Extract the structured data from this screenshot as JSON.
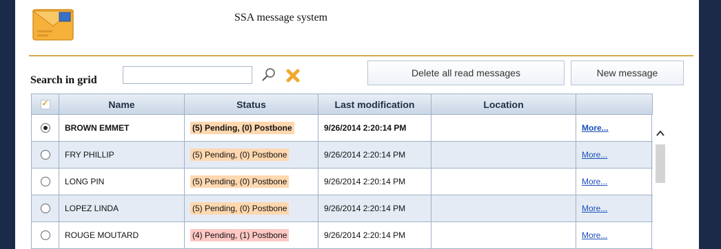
{
  "header": {
    "title": "SSA message system"
  },
  "search": {
    "label": "Search in grid",
    "value": "",
    "placeholder": ""
  },
  "toolbar": {
    "delete_read_label": "Delete all read messages",
    "new_message_label": "New message"
  },
  "grid": {
    "columns": [
      "",
      "Name",
      "Status",
      "Last modification",
      "Location",
      ""
    ],
    "rows": [
      {
        "name": "BROWN EMMET",
        "status": "(5) Pending, (0) Postbone",
        "modified": "9/26/2014 2:20:14 PM",
        "location": "",
        "more": "More..."
      },
      {
        "name": "FRY PHILLIP",
        "status": "(5) Pending, (0) Postbone",
        "modified": "9/26/2014 2:20:14 PM",
        "location": "",
        "more": "More..."
      },
      {
        "name": "LONG PIN",
        "status": "(5) Pending, (0) Postbone",
        "modified": "9/26/2014 2:20:14 PM",
        "location": "",
        "more": "More..."
      },
      {
        "name": "LOPEZ LINDA",
        "status": "(5) Pending, (0) Postbone",
        "modified": "9/26/2014 2:20:14 PM",
        "location": "",
        "more": "More..."
      },
      {
        "name": "ROUGE MOUTARD",
        "status": "(4) Pending, (1) Postbone",
        "modified": "9/26/2014 2:20:14 PM",
        "location": "",
        "more": "More..."
      }
    ]
  },
  "colors": {
    "accent_rule": "#d8a84a",
    "frame": "#1c2a4a",
    "status_orange": "#ffd8b0",
    "status_red": "#ffc9c4",
    "link": "#1a4fb8"
  },
  "icons": [
    "envelope-icon",
    "search-icon",
    "clear-icon",
    "checkbox-icon",
    "chevron-up-icon"
  ]
}
